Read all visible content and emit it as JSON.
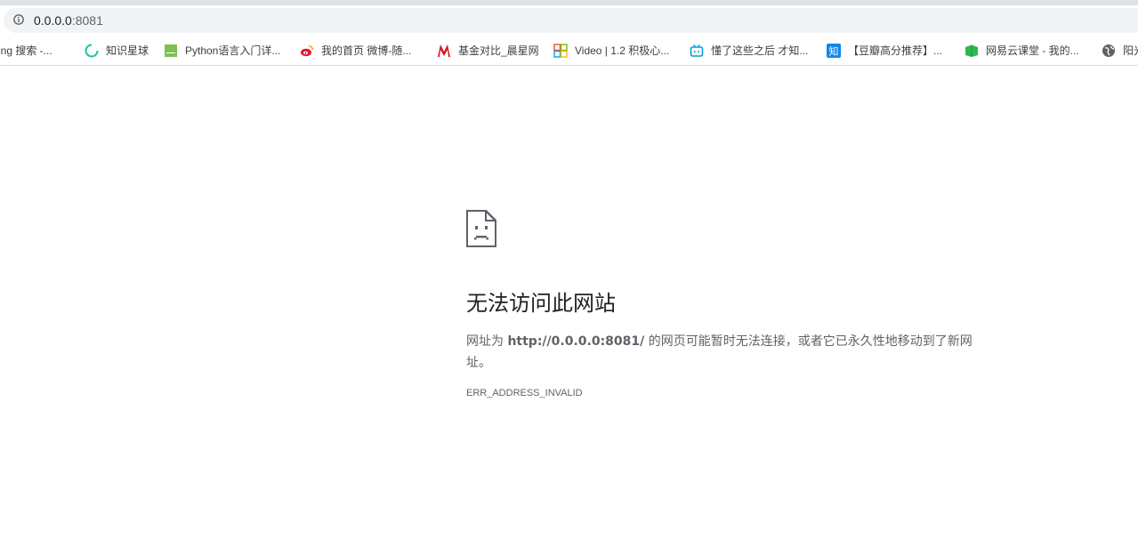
{
  "address_bar": {
    "host": "0.0.0.0",
    "port": ":8081"
  },
  "bookmarks": [
    {
      "label": "ing 搜索 -...",
      "icon": "bing-icon"
    },
    {
      "label": "知识星球",
      "icon": "zsxq-icon"
    },
    {
      "label": "Python语言入门详...",
      "icon": "green-square-icon"
    },
    {
      "label": "我的首页 微博-随...",
      "icon": "weibo-icon"
    },
    {
      "label": "基金对比_晨星网",
      "icon": "morningstar-icon"
    },
    {
      "label": "Video | 1.2 积极心...",
      "icon": "windows-logo-icon"
    },
    {
      "label": "懂了这些之后 才知...",
      "icon": "bilibili-icon"
    },
    {
      "label": "【豆瓣高分推荐】...",
      "icon": "zhihu-icon"
    },
    {
      "label": "网易云课堂 - 我的...",
      "icon": "study163-icon"
    },
    {
      "label": "阳光",
      "icon": "globe-icon"
    }
  ],
  "error": {
    "title": "无法访问此网站",
    "desc_prefix": "网址为 ",
    "desc_url": "http://0.0.0.0:8081/",
    "desc_suffix": " 的网页可能暂时无法连接，或者它已永久性地移动到了新网址。",
    "code": "ERR_ADDRESS_INVALID"
  }
}
